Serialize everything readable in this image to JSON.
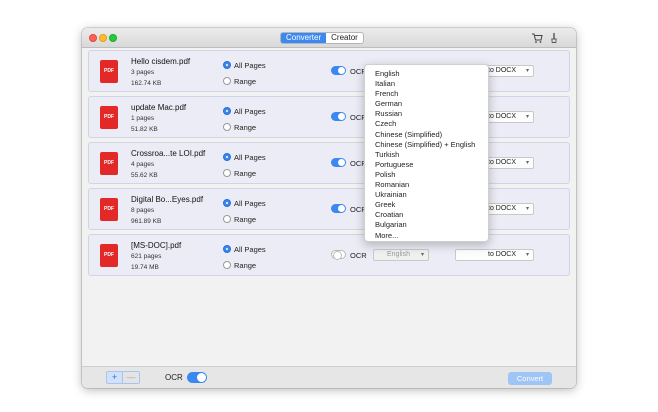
{
  "toolbar": {
    "tabs": [
      {
        "label": "Converter",
        "active": true
      },
      {
        "label": "Creator",
        "active": false
      }
    ],
    "icons": [
      "cart-icon",
      "brush-icon"
    ]
  },
  "files": [
    {
      "icon_text": "PDF",
      "name": "Hello cisdem.pdf",
      "pages": "3 pages",
      "size": "162.74 KB",
      "all_pages": "All Pages",
      "range": "Range",
      "ocr_label": "OCR",
      "ocr_on": true,
      "language": "English",
      "format": "to DOCX"
    },
    {
      "icon_text": "PDF",
      "name": "update Mac.pdf",
      "pages": "1 pages",
      "size": "51.82 KB",
      "all_pages": "All Pages",
      "range": "Range",
      "ocr_label": "OCR",
      "ocr_on": true,
      "language": "English",
      "format": "to DOCX"
    },
    {
      "icon_text": "PDF",
      "name": "Crossroa...te LOI.pdf",
      "pages": "4 pages",
      "size": "55.62 KB",
      "all_pages": "All Pages",
      "range": "Range",
      "ocr_label": "OCR",
      "ocr_on": true,
      "language": "English",
      "format": "to DOCX"
    },
    {
      "icon_text": "PDF",
      "name": "Digital Bo...Eyes.pdf",
      "pages": "8 pages",
      "size": "961.89 KB",
      "all_pages": "All Pages",
      "range": "Range",
      "ocr_label": "OCR",
      "ocr_on": true,
      "language": "English",
      "format": "to DOCX"
    },
    {
      "icon_text": "PDF",
      "name": "[MS-DOC].pdf",
      "pages": "621 pages",
      "size": "19.74 MB",
      "all_pages": "All Pages",
      "range": "Range",
      "ocr_label": "OCR",
      "ocr_on": false,
      "language": "English",
      "format": "to DOCX"
    }
  ],
  "language_menu": [
    "English",
    "Italian",
    "French",
    "German",
    "Russian",
    "Czech",
    "Chinese (Simplified)",
    "Chinese (Simplified) + English",
    "Turkish",
    "Portuguese",
    "Polish",
    "Romanian",
    "Ukrainian",
    "Greek",
    "Croatian",
    "Bulgarian",
    "More..."
  ],
  "bottom": {
    "add_label": "+",
    "remove_label": "—",
    "ocr_label": "OCR",
    "ocr_on": true,
    "convert_label": "Convert"
  },
  "colors": {
    "accent": "#3b88f0",
    "pdf_icon": "#e32828",
    "row_bg": "#ececf6"
  }
}
